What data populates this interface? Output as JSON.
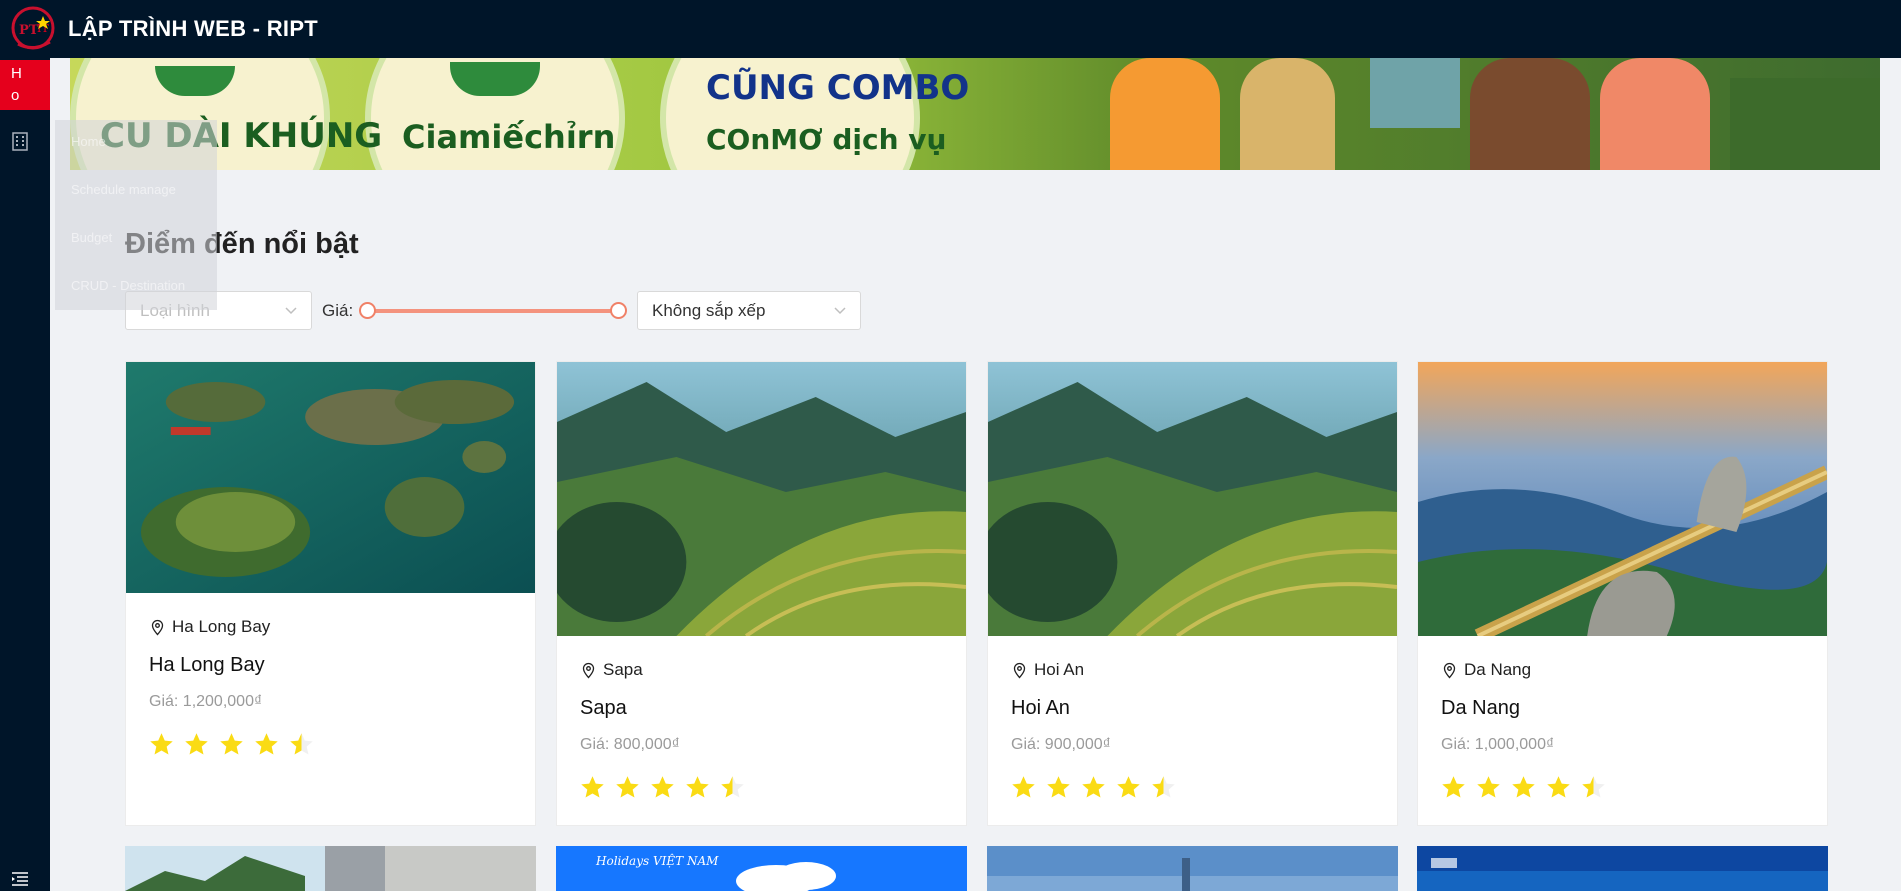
{
  "header": {
    "title": "LẬP TRÌNH WEB - RIPT",
    "logo_text": "PTIT"
  },
  "sidebar": {
    "active_letters": "H\no",
    "icons": [
      "building-icon",
      "menu-collapse-icon"
    ]
  },
  "float_menu": {
    "items": [
      "Home",
      "Schedule manage",
      "Budget",
      "CRUD - Destination"
    ]
  },
  "banner": {
    "texts": [
      "CU DÀI KHÚNG",
      "Ciamiếchỉrn",
      "CŨNG COMBO",
      "COnMƠ dịch vụ"
    ]
  },
  "section": {
    "title": "Điểm đến nổi bật"
  },
  "filters": {
    "type_placeholder": "Loại hình",
    "price_label": "Giá:",
    "price_range": [
      0,
      1
    ],
    "sort_value": "Không sắp xếp"
  },
  "colors": {
    "header_bg": "#001529",
    "accent": "#e5001c",
    "slider": "#f08167",
    "star": "#fadb14"
  },
  "cards": [
    {
      "location": "Ha Long Bay",
      "name": "Ha Long Bay",
      "price": "Giá: 1,200,000₫",
      "rating": 4.5
    },
    {
      "location": "Sapa",
      "name": "Sapa",
      "price": "Giá: 800,000₫",
      "rating": 4.5
    },
    {
      "location": "Hoi An",
      "name": "Hoi An",
      "price": "Giá: 900,000₫",
      "rating": 4.5
    },
    {
      "location": "Da Nang",
      "name": "Da Nang",
      "price": "Giá: 1,000,000₫",
      "rating": 4.5
    }
  ],
  "bottom_row": {
    "labels": [
      "Holidays VIỆT NAM"
    ]
  }
}
